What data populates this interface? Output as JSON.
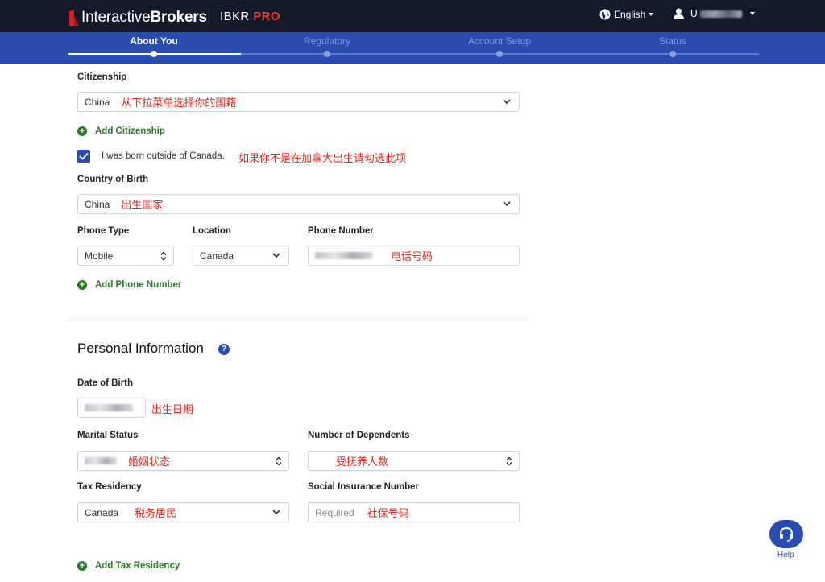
{
  "header": {
    "logo_text_light": "Interactive",
    "logo_text_bold": "Brokers",
    "product": "IBKR",
    "product_suffix": "PRO",
    "language": "English",
    "user_initial": "U"
  },
  "progress": {
    "steps": [
      {
        "label": "About You",
        "active": true
      },
      {
        "label": "Regulatory",
        "active": false
      },
      {
        "label": "Account Setup",
        "active": false
      },
      {
        "label": "Status",
        "active": false
      }
    ]
  },
  "citizenship": {
    "label": "Citizenship",
    "value": "China",
    "note": "从下拉菜单选择你的国籍",
    "add_label": "Add Citizenship"
  },
  "born_outside": {
    "checked": true,
    "label": "I was born outside of Canada.",
    "note": "如果你不是在加拿大出生请勾选此项"
  },
  "country_of_birth": {
    "label": "Country of Birth",
    "value": "China",
    "note": "出生国家"
  },
  "phone": {
    "type_label": "Phone Type",
    "type_value": "Mobile",
    "location_label": "Location",
    "location_value": "Canada",
    "number_label": "Phone Number",
    "number_note": "电话号码",
    "add_label": "Add Phone Number"
  },
  "personal": {
    "title": "Personal Information",
    "help_glyph": "?",
    "dob_label": "Date of Birth",
    "dob_note": "出生日期",
    "marital_label": "Marital Status",
    "marital_note": "婚姻状态",
    "dependents_label": "Number of Dependents",
    "dependents_note": "受抚养人数",
    "tax_label": "Tax Residency",
    "tax_value": "Canada",
    "tax_note": "税务居民",
    "sin_label": "Social Insurance Number",
    "sin_placeholder": "Required",
    "sin_note": "社保号码",
    "add_tax_label": "Add Tax Residency"
  },
  "help": {
    "label": "Help"
  },
  "colors": {
    "topbar": "#141a2a",
    "progress": "#2a4cb0",
    "accent_green": "#2a7a2a",
    "note_red": "#e0261b"
  }
}
